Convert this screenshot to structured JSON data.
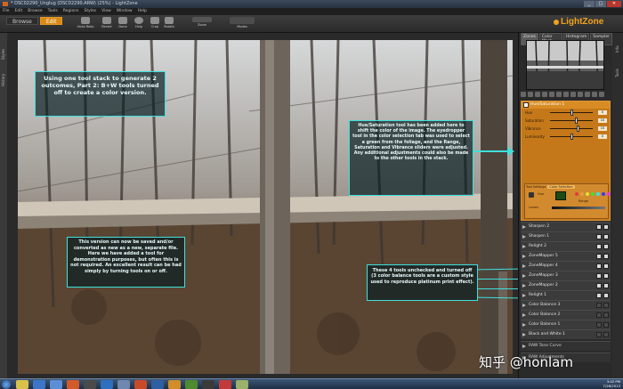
{
  "window": {
    "title": "* DSC02290_Unglug (DSC02290.ARW) (25%) - LightZone"
  },
  "menu": [
    "File",
    "Edit",
    "Browse",
    "Tools",
    "Regions",
    "Styles",
    "View",
    "Window",
    "Help"
  ],
  "modes": {
    "browse": "Browse",
    "edit": "Edit"
  },
  "toolbar": {
    "buttons": [
      "Undo Redo",
      "Revert",
      "Done",
      "Help",
      "Crop",
      "Rotate",
      "Zoom",
      "Modes"
    ]
  },
  "brand": {
    "logo": "LightZone",
    "accent": "#f1a21d"
  },
  "left_strip": {
    "styles": "Styles",
    "history": "History"
  },
  "right_strip": {
    "info": "Info",
    "tools": "Tools"
  },
  "panel": {
    "tabs": [
      "Zones",
      "Color Mask",
      "Histogram",
      "Sampler"
    ],
    "hue_tool": {
      "title": "Hue/Saturation 1",
      "rows": [
        {
          "label": "Hue",
          "value": "0",
          "knob": 0.5
        },
        {
          "label": "Saturation",
          "value": "10",
          "knob": 0.62
        },
        {
          "label": "Vibrance",
          "value": "15",
          "knob": 0.66
        },
        {
          "label": "Luminosity",
          "value": "0",
          "knob": 0.5
        }
      ],
      "sub_tabs": [
        "Tool Settings",
        "Color Selection"
      ],
      "selection_labels": [
        "Hue",
        "Range",
        "Levels"
      ],
      "dot_colors": [
        "#e23b3b",
        "#e2a03b",
        "#e2e23b",
        "#3be23b",
        "#3be2e2",
        "#3b3be2",
        "#e23be2"
      ]
    },
    "tools": [
      {
        "name": "Sharpen 2",
        "on": true
      },
      {
        "name": "Sharpen 1",
        "on": true
      },
      {
        "name": "Relight 2",
        "on": true
      },
      {
        "name": "ZoneMapper 5",
        "on": true
      },
      {
        "name": "ZoneMapper 4",
        "on": true
      },
      {
        "name": "ZoneMapper 3",
        "on": true
      },
      {
        "name": "ZoneMapper 2",
        "on": true
      },
      {
        "name": "Relight 1",
        "on": true
      },
      {
        "name": "Color Balance 3",
        "on": false
      },
      {
        "name": "Color Balance 2",
        "on": false
      },
      {
        "name": "Color Balance 1",
        "on": false
      },
      {
        "name": "Black and White 1",
        "on": false
      }
    ],
    "raw_tools": [
      "RAW Tone Curve",
      "RAW Adjustments"
    ]
  },
  "callouts": {
    "top_left": "Using one tool stack to generate 2 outcomes, Part 2: B+W tools turned off to create a color version.",
    "right": "Hue/Saturation tool has been added here to shift the color of the image. The eyedropper tool in the color selection tab was used to select a green from the foliage, and the Range, Saturation and Vibrance sliders were adjusted. Any additional adjustments could also be made to the other tools in the stack.",
    "bottom_left": "This version can now be saved and/or converted as new as a new, separate file. Here we have added a tool for demonstration purposes, but often this is not required. An excellent result can be had simply by turning tools on or off.",
    "bottom_right": "These 4 tools unchecked and turned off (3 color balance tools are a custom style used to reproduce platinum print effect).",
    "color": "#3ee0dc"
  },
  "taskbar": {
    "icon_colors": [
      "#d9c24a",
      "#3c76c9",
      "#5c8fd8",
      "#d25a2b",
      "#4a4a4a",
      "#2f6fc0",
      "#6e88b0",
      "#c84a2a",
      "#2e5fa3",
      "#d08d2a",
      "#4e8a2e",
      "#3a3a3a",
      "#c23a3a",
      "#9bb06a"
    ],
    "time": "3:42 PM",
    "date": "7/26/2013"
  },
  "watermark": "知乎 @honlam"
}
